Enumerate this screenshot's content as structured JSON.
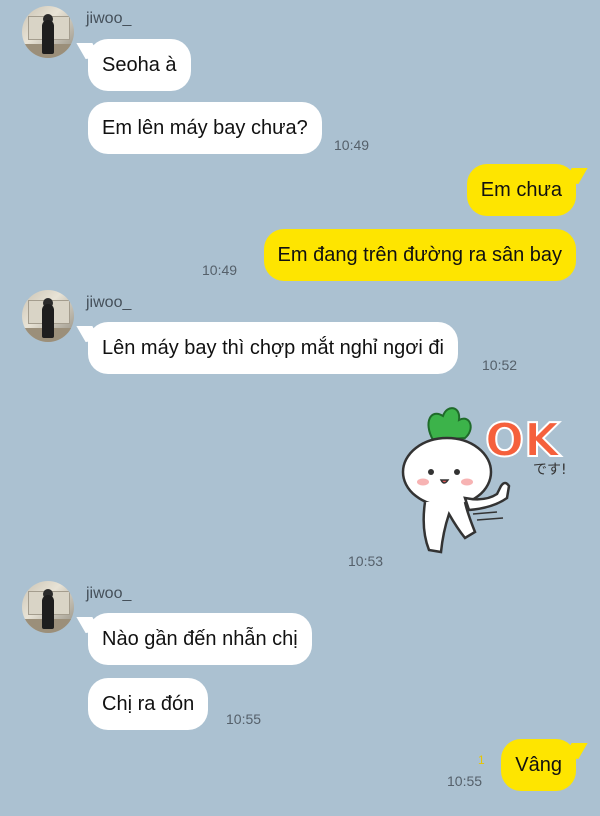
{
  "sender_name": "jiwoo_",
  "messages": [
    {
      "text": "Seoha à"
    },
    {
      "text": "Em lên máy bay chưa?",
      "time": "10:49"
    },
    {
      "text": "Em chưa"
    },
    {
      "text": "Em đang trên đường ra sân bay",
      "time": "10:49"
    },
    {
      "text": "Lên máy bay thì chợp mắt nghỉ ngơi đi",
      "time": "10:52"
    },
    {
      "sticker_text": "OK",
      "sticker_subtext": "です!",
      "time": "10:53"
    },
    {
      "text": "Nào gần đến nhẫn chị"
    },
    {
      "text": "Chị ra đón",
      "time": "10:55"
    },
    {
      "text": "Vâng",
      "time": "10:55",
      "unread": "1"
    }
  ],
  "colors": {
    "background": "#abc1d1",
    "incoming_bubble": "#ffffff",
    "outgoing_bubble": "#fee500",
    "sticker_ok": "#f5603c",
    "sticker_leaf": "#3cb34a"
  }
}
